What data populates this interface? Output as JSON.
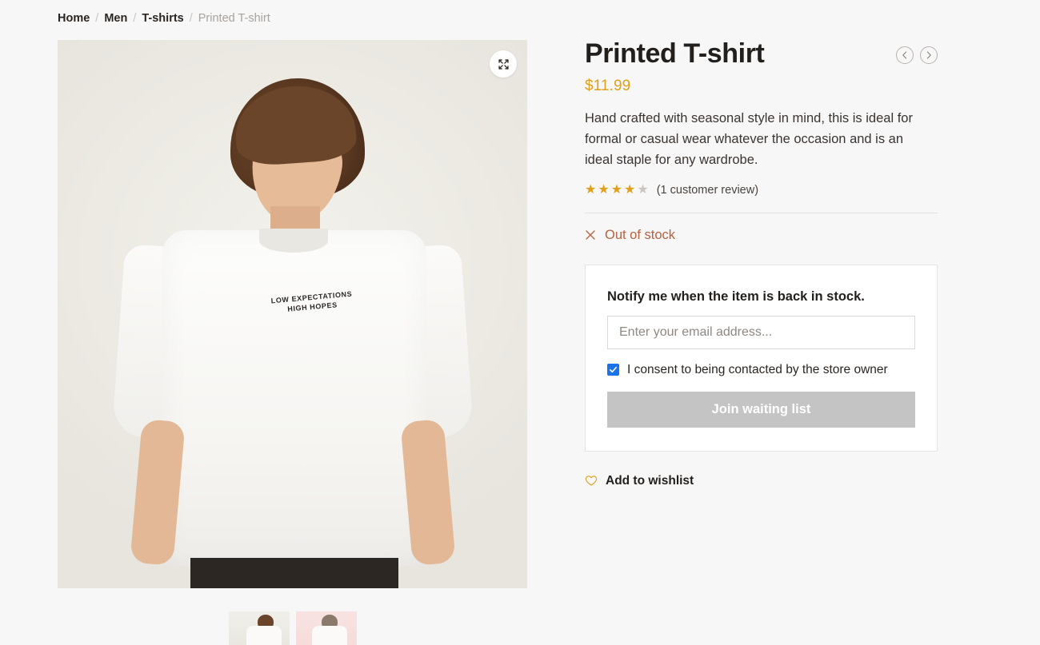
{
  "breadcrumb": {
    "separator": "/",
    "items": [
      {
        "label": "Home",
        "current": false
      },
      {
        "label": "Men",
        "current": false
      },
      {
        "label": "T-shirts",
        "current": false
      },
      {
        "label": "Printed T-shirt",
        "current": true
      }
    ]
  },
  "gallery": {
    "expand_icon": "expand-arrows-icon",
    "shirt_print_line1": "LOW EXPECTATIONS",
    "shirt_print_line2": "HIGH HOPES",
    "thumbnails": [
      {
        "name": "thumbnail-front-view"
      },
      {
        "name": "thumbnail-back-view"
      }
    ]
  },
  "product": {
    "title": "Printed T-shirt",
    "price": "$11.99",
    "description": "Hand crafted with seasonal style in mind, this is ideal for formal or casual wear whatever the occasion and is an ideal staple for any wardrobe.",
    "rating_value": 4,
    "rating_max": 5,
    "review_count_text": "(1 customer review)",
    "stock_status": "Out of stock",
    "stock_icon": "x-icon",
    "prev_label": "‹",
    "next_label": "›"
  },
  "notify": {
    "title": "Notify me when the item is back in stock.",
    "email_placeholder": "Enter your email address...",
    "email_value": "",
    "consent_label": "I consent to being contacted by the store owner",
    "consent_checked": true,
    "submit_label": "Join waiting list"
  },
  "wishlist": {
    "icon": "heart-icon",
    "label": "Add to wishlist"
  },
  "colors": {
    "page_background": "#f7f7f7",
    "accent_amber": "#e0a01b",
    "out_of_stock": "#b6613f",
    "checkbox_blue": "#1a73e8",
    "disabled_button": "#c4c4c4"
  }
}
